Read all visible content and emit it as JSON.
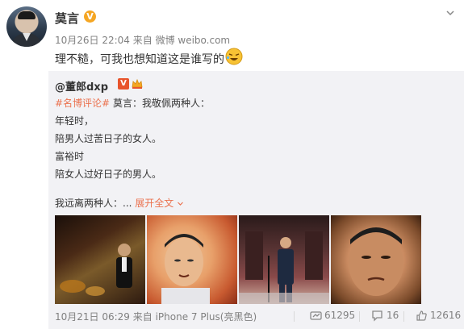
{
  "post": {
    "author": "莫言",
    "verified_badge": "V",
    "meta": "10月26日 22:04 来自 微博 weibo.com",
    "text": "理不糙，可我也想知道这是谁写的"
  },
  "repost": {
    "author": "@董郎dxp",
    "verified_badge": "V",
    "lines": [
      {
        "hashtag": "#名博评论#",
        "rest": " 莫言：我敬佩两种人："
      },
      {
        "text": "年轻时，"
      },
      {
        "text": "陪男人过苦日子的女人。"
      },
      {
        "text": "富裕时"
      },
      {
        "text": "陪女人过好日子的男人。"
      }
    ],
    "line_last": "我远离两种人：...",
    "expand_label": "展开全文",
    "meta": "10月21日 06:29 来自 iPhone 7 Plus(亮黑色)",
    "repost_count": "61295",
    "comment_count": "16",
    "like_count": "12616"
  },
  "icons": {
    "chevron": "chevron-down-icon",
    "emoji": "laughing-emoji-icon",
    "crown": "crown-badge-icon",
    "repost": "repost-icon",
    "comment": "comment-icon",
    "like": "like-icon"
  },
  "colors": {
    "accent_orange": "#eb7350",
    "verified_gold": "#f5a623",
    "repost_bg": "#f2f2f5",
    "meta_gray": "#808080"
  }
}
